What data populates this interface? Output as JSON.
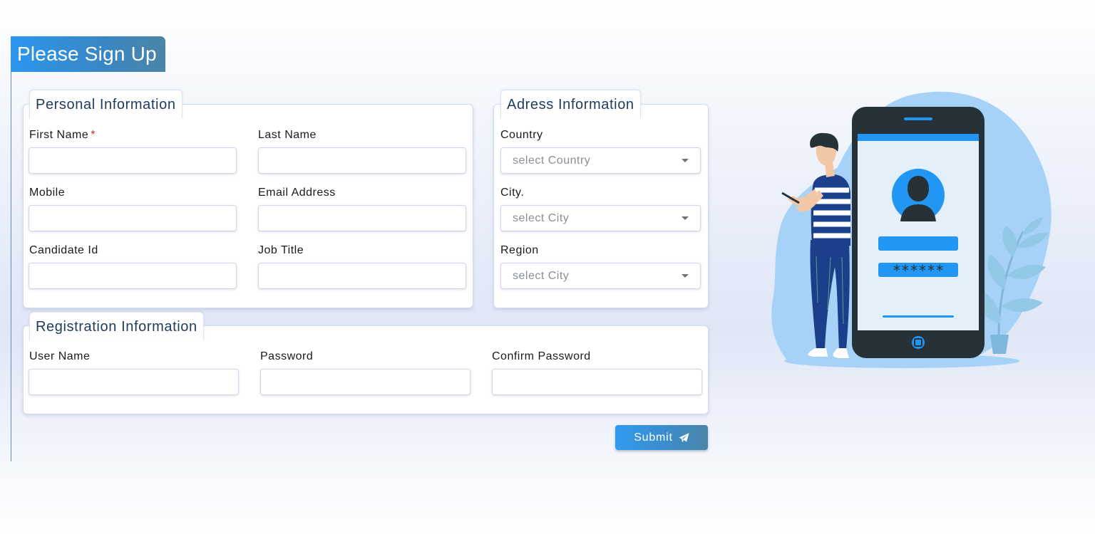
{
  "header": {
    "title": "Please Sign Up"
  },
  "personal": {
    "legend": "Personal Information",
    "first_name_label": "First Name",
    "required_mark": "*",
    "last_name_label": "Last Name",
    "mobile_label": "Mobile",
    "email_label": "Email Address",
    "candidate_id_label": "Candidate Id",
    "job_title_label": "Job Title"
  },
  "address": {
    "legend": "Adress Information",
    "country_label": "Country",
    "country_placeholder": "select Country",
    "city_label": "City.",
    "city_placeholder": "select City",
    "region_label": "Region",
    "region_placeholder": "select City"
  },
  "registration": {
    "legend": "Registration Information",
    "username_label": "User Name",
    "password_label": "Password",
    "confirm_label": "Confirm Password"
  },
  "actions": {
    "submit_label": "Submit",
    "submit_icon": "paper-plane-icon"
  },
  "illustration": {
    "password_mask": "******",
    "colors": {
      "blob": "#a7d2f7",
      "phone_frame": "#263238",
      "phone_screen": "#e3eff9",
      "accent": "#2196f3"
    }
  },
  "colors": {
    "title_gradient_start": "#2a97ee",
    "title_gradient_end": "#4b85a6",
    "legend_text": "#1d3b5d",
    "required": "#e0261b"
  }
}
